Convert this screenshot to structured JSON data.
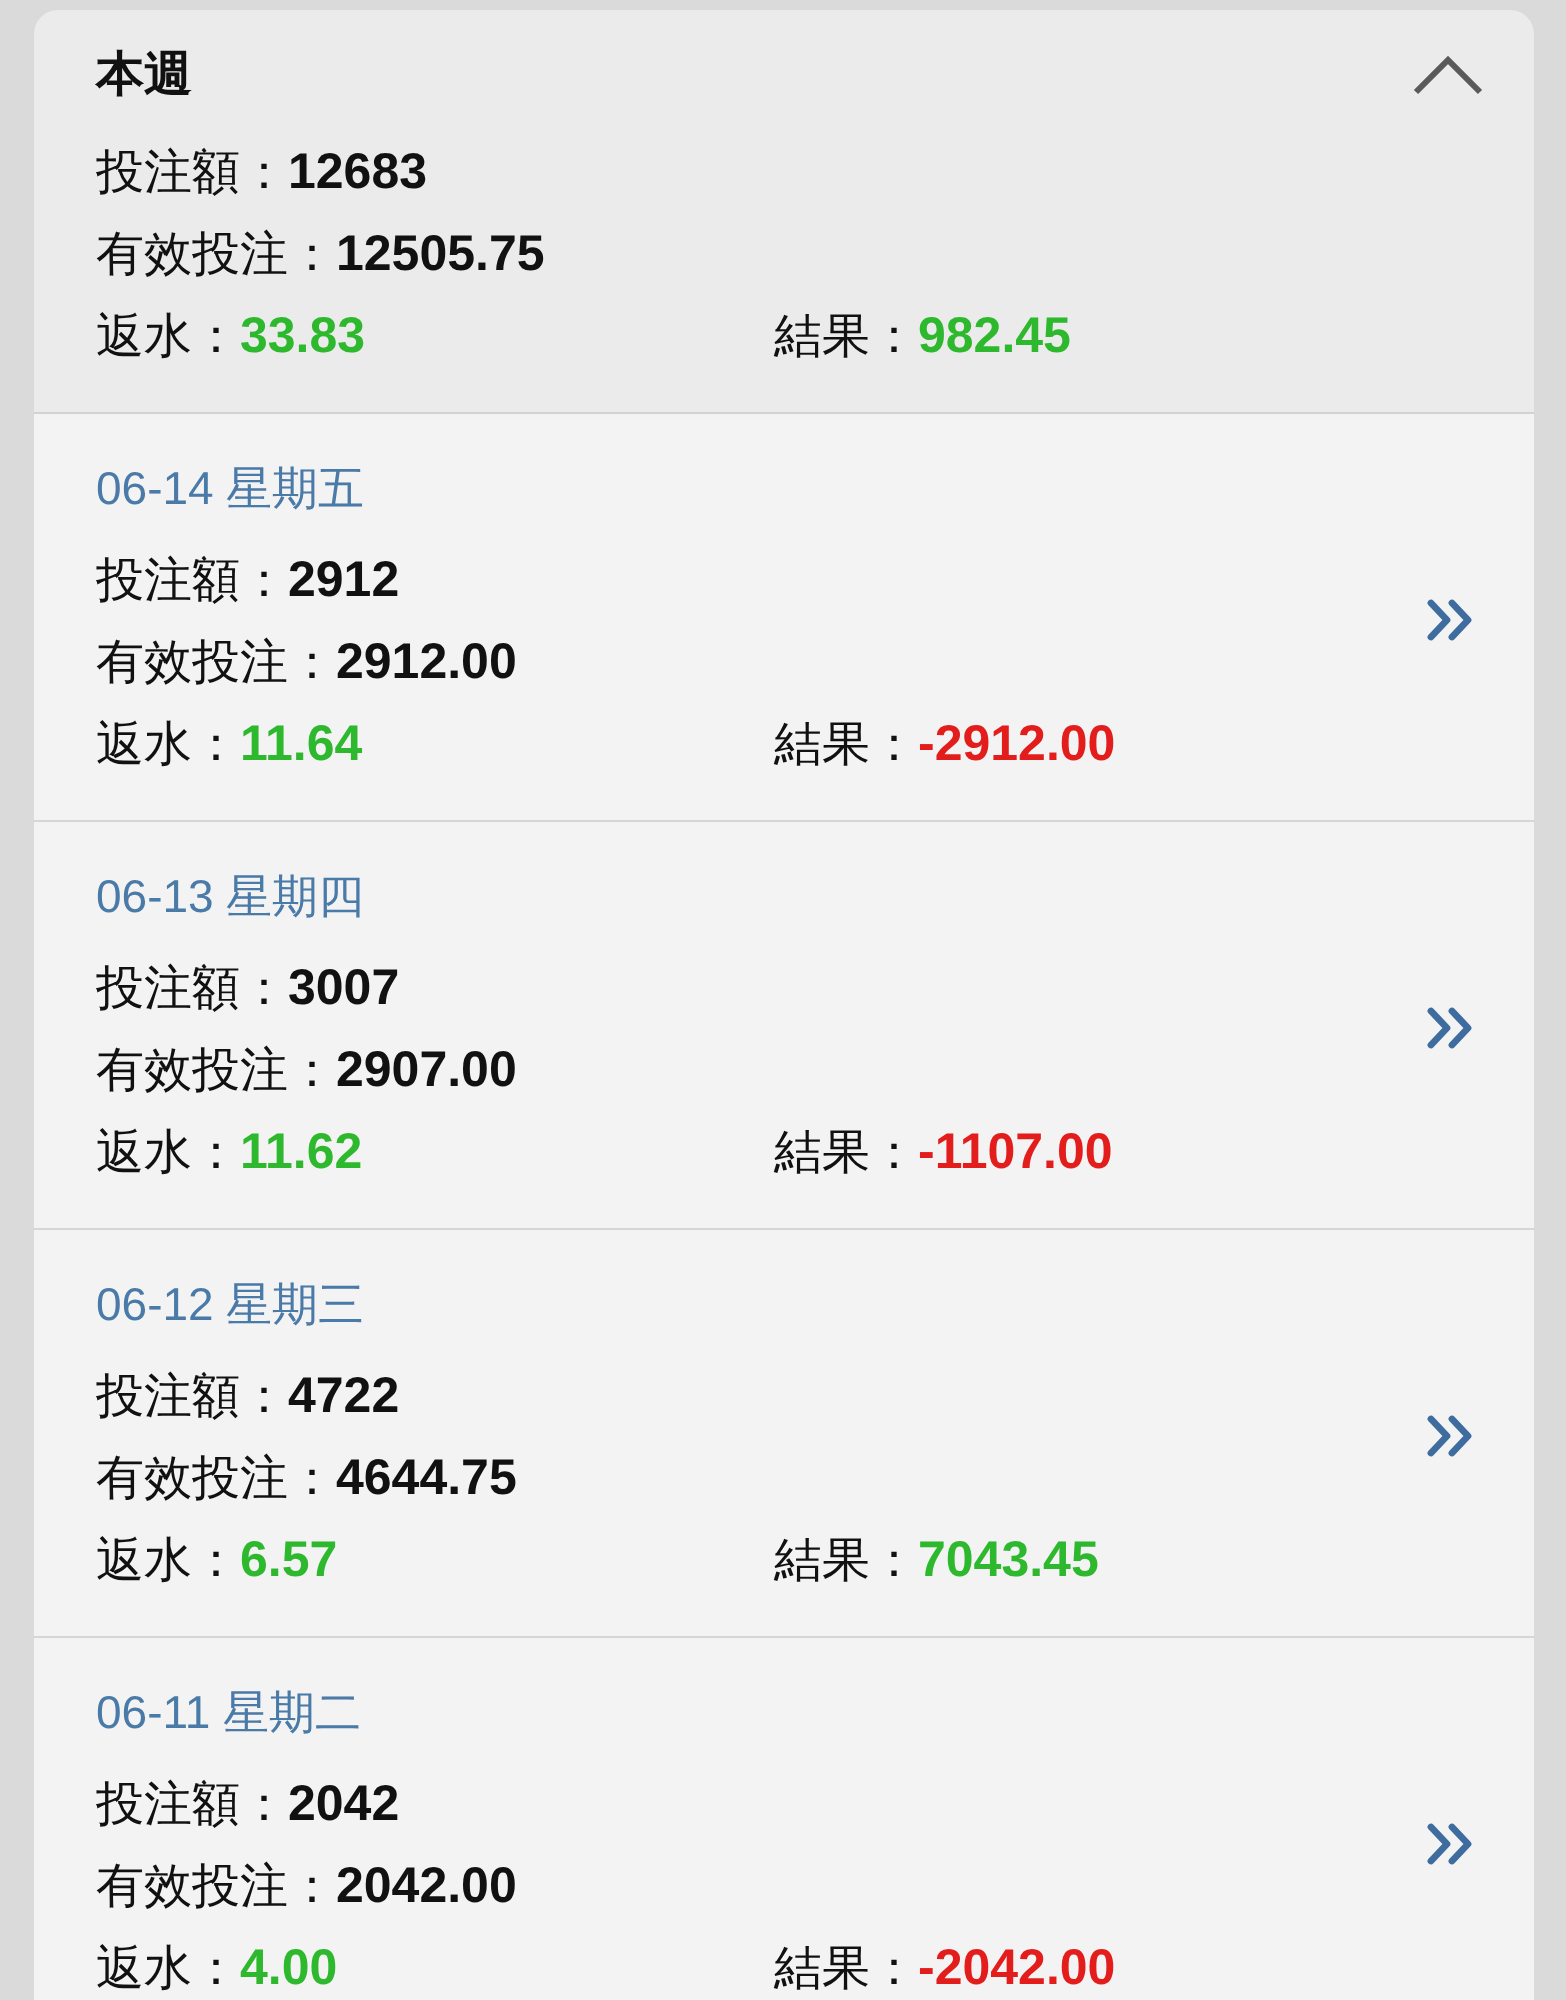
{
  "summary": {
    "title": "本週",
    "expanded": true,
    "lines": [
      [
        {
          "label": "投注額：",
          "value": "12683"
        }
      ],
      [
        {
          "label": "有效投注：",
          "value": "12505.75"
        }
      ],
      [
        {
          "label": "返水：",
          "value": "33.83",
          "color": "#2eb82e"
        },
        {
          "label": "結果：",
          "value": "982.45",
          "color": "#2eb82e"
        }
      ]
    ]
  },
  "days": [
    {
      "date": "06-14 星期五",
      "lines": [
        [
          {
            "label": "投注額：",
            "value": "2912"
          }
        ],
        [
          {
            "label": "有效投注：",
            "value": "2912.00"
          }
        ],
        [
          {
            "label": "返水：",
            "value": "11.64",
            "color": "#2eb82e"
          },
          {
            "label": "結果：",
            "value": "-2912.00",
            "color": "#e31c1c"
          }
        ]
      ]
    },
    {
      "date": "06-13 星期四",
      "lines": [
        [
          {
            "label": "投注額：",
            "value": "3007"
          }
        ],
        [
          {
            "label": "有效投注：",
            "value": "2907.00"
          }
        ],
        [
          {
            "label": "返水：",
            "value": "11.62",
            "color": "#2eb82e"
          },
          {
            "label": "結果：",
            "value": "-1107.00",
            "color": "#e31c1c"
          }
        ]
      ]
    },
    {
      "date": "06-12 星期三",
      "lines": [
        [
          {
            "label": "投注額：",
            "value": "4722"
          }
        ],
        [
          {
            "label": "有效投注：",
            "value": "4644.75"
          }
        ],
        [
          {
            "label": "返水：",
            "value": "6.57",
            "color": "#2eb82e"
          },
          {
            "label": "結果：",
            "value": "7043.45",
            "color": "#2eb82e"
          }
        ]
      ]
    },
    {
      "date": "06-11 星期二",
      "lines": [
        [
          {
            "label": "投注額：",
            "value": "2042"
          }
        ],
        [
          {
            "label": "有效投注：",
            "value": "2042.00"
          }
        ],
        [
          {
            "label": "返水：",
            "value": "4.00",
            "color": "#2eb82e"
          },
          {
            "label": "結果：",
            "value": "-2042.00",
            "color": "#e31c1c"
          }
        ]
      ]
    }
  ]
}
